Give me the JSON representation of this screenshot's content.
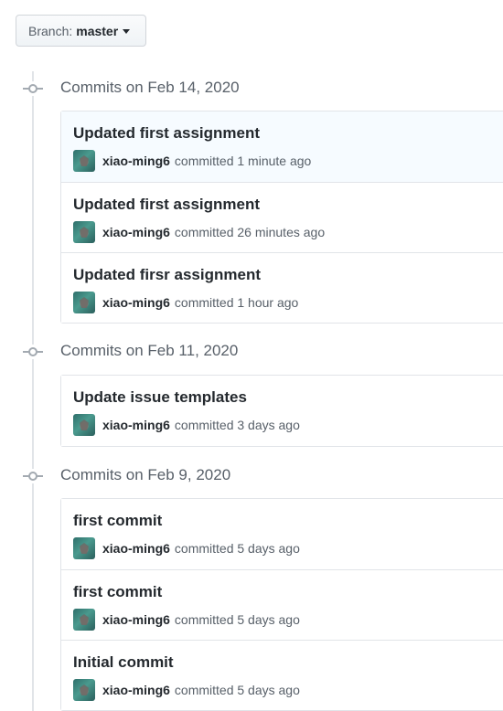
{
  "branch": {
    "label": "Branch:",
    "value": "master"
  },
  "groups": [
    {
      "title": "Commits on Feb 14, 2020",
      "commits": [
        {
          "message": "Updated first assignment",
          "author": "xiao-ming6",
          "action": "committed",
          "time": "1 minute ago"
        },
        {
          "message": "Updated first assignment",
          "author": "xiao-ming6",
          "action": "committed",
          "time": "26 minutes ago"
        },
        {
          "message": "Updated firsr assignment",
          "author": "xiao-ming6",
          "action": "committed",
          "time": "1 hour ago"
        }
      ]
    },
    {
      "title": "Commits on Feb 11, 2020",
      "commits": [
        {
          "message": "Update issue templates",
          "author": "xiao-ming6",
          "action": "committed",
          "time": "3 days ago"
        }
      ]
    },
    {
      "title": "Commits on Feb 9, 2020",
      "commits": [
        {
          "message": "first commit",
          "author": "xiao-ming6",
          "action": "committed",
          "time": "5 days ago"
        },
        {
          "message": "first commit",
          "author": "xiao-ming6",
          "action": "committed",
          "time": "5 days ago"
        },
        {
          "message": "Initial commit",
          "author": "xiao-ming6",
          "action": "committed",
          "time": "5 days ago"
        }
      ]
    }
  ]
}
